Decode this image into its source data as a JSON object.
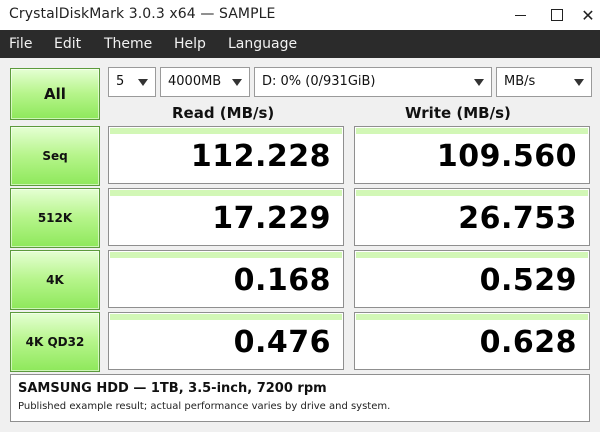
{
  "window": {
    "title": "CrystalDiskMark 3.0.3 x64  —  SAMPLE",
    "minimize_label": "—",
    "close_label": "✕"
  },
  "menu": {
    "items": [
      "File",
      "Edit",
      "Theme",
      "Help",
      "Language"
    ]
  },
  "controls": {
    "all_label": "All",
    "count_value": "5",
    "size_value": "4000MB",
    "drive_value": "D: 0% (0/931GiB)",
    "unit_value": "MB/s"
  },
  "headers": {
    "read": "Read (MB/s)",
    "write": "Write (MB/s)"
  },
  "rows": [
    {
      "label": "Seq",
      "read": "112.228",
      "write": "109.560"
    },
    {
      "label": "512K",
      "read": "17.229",
      "write": "26.753"
    },
    {
      "label": "4K",
      "read": "0.168",
      "write": "0.529"
    },
    {
      "label": "4K QD32",
      "read": "0.476",
      "write": "0.628"
    }
  ],
  "comment": {
    "title": "SAMSUNG HDD — 1TB, 3.5-inch, 7200 rpm",
    "note": "Published example result; actual performance varies by drive and system."
  },
  "colors": {
    "button_green_top": "#e5ffd3",
    "button_green_bottom": "#8ee85b",
    "bar_green": "#d2f7b6",
    "menubar_bg": "#2b2b2b"
  }
}
